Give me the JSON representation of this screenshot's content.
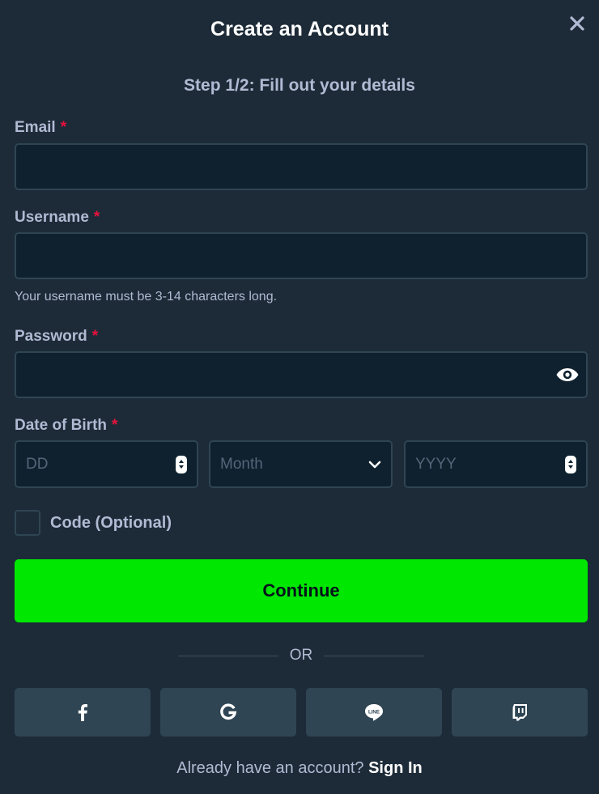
{
  "header": {
    "title": "Create an Account",
    "close_icon": "close-icon"
  },
  "step": "Step 1/2: Fill out your details",
  "form": {
    "email": {
      "label": "Email",
      "required_mark": "*",
      "value": ""
    },
    "username": {
      "label": "Username",
      "required_mark": "*",
      "value": "",
      "hint": "Your username must be 3-14 characters long."
    },
    "password": {
      "label": "Password",
      "required_mark": "*",
      "value": "",
      "toggle_icon": "eye-icon"
    },
    "dob": {
      "label": "Date of Birth",
      "required_mark": "*",
      "day_placeholder": "DD",
      "month_placeholder": "Month",
      "year_placeholder": "YYYY"
    },
    "code": {
      "label": "Code (Optional)",
      "checked": false
    }
  },
  "continue_label": "Continue",
  "divider": "OR",
  "social": [
    "facebook-icon",
    "google-icon",
    "line-icon",
    "twitch-icon"
  ],
  "footer": {
    "prompt": "Already have an account?",
    "link": "Sign In"
  },
  "colors": {
    "background": "#1d2b38",
    "input_bg": "#0f212e",
    "border": "#2f4553",
    "accent": "#00e701",
    "required": "#e9113c"
  }
}
